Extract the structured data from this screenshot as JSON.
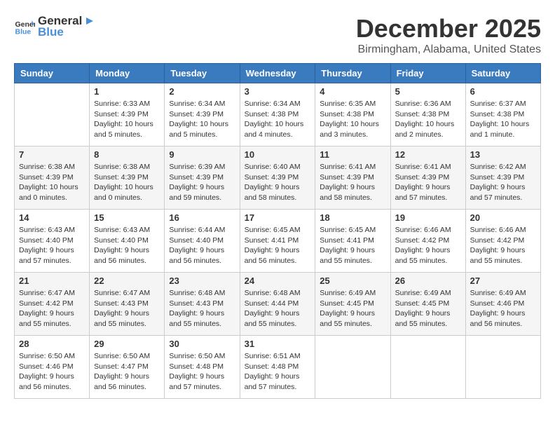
{
  "header": {
    "logo_general": "General",
    "logo_blue": "Blue",
    "month_title": "December 2025",
    "location": "Birmingham, Alabama, United States"
  },
  "days_of_week": [
    "Sunday",
    "Monday",
    "Tuesday",
    "Wednesday",
    "Thursday",
    "Friday",
    "Saturday"
  ],
  "weeks": [
    [
      {
        "day": "",
        "info": ""
      },
      {
        "day": "1",
        "info": "Sunrise: 6:33 AM\nSunset: 4:39 PM\nDaylight: 10 hours\nand 5 minutes."
      },
      {
        "day": "2",
        "info": "Sunrise: 6:34 AM\nSunset: 4:39 PM\nDaylight: 10 hours\nand 5 minutes."
      },
      {
        "day": "3",
        "info": "Sunrise: 6:34 AM\nSunset: 4:38 PM\nDaylight: 10 hours\nand 4 minutes."
      },
      {
        "day": "4",
        "info": "Sunrise: 6:35 AM\nSunset: 4:38 PM\nDaylight: 10 hours\nand 3 minutes."
      },
      {
        "day": "5",
        "info": "Sunrise: 6:36 AM\nSunset: 4:38 PM\nDaylight: 10 hours\nand 2 minutes."
      },
      {
        "day": "6",
        "info": "Sunrise: 6:37 AM\nSunset: 4:38 PM\nDaylight: 10 hours\nand 1 minute."
      }
    ],
    [
      {
        "day": "7",
        "info": "Sunrise: 6:38 AM\nSunset: 4:39 PM\nDaylight: 10 hours\nand 0 minutes."
      },
      {
        "day": "8",
        "info": "Sunrise: 6:38 AM\nSunset: 4:39 PM\nDaylight: 10 hours\nand 0 minutes."
      },
      {
        "day": "9",
        "info": "Sunrise: 6:39 AM\nSunset: 4:39 PM\nDaylight: 9 hours\nand 59 minutes."
      },
      {
        "day": "10",
        "info": "Sunrise: 6:40 AM\nSunset: 4:39 PM\nDaylight: 9 hours\nand 58 minutes."
      },
      {
        "day": "11",
        "info": "Sunrise: 6:41 AM\nSunset: 4:39 PM\nDaylight: 9 hours\nand 58 minutes."
      },
      {
        "day": "12",
        "info": "Sunrise: 6:41 AM\nSunset: 4:39 PM\nDaylight: 9 hours\nand 57 minutes."
      },
      {
        "day": "13",
        "info": "Sunrise: 6:42 AM\nSunset: 4:39 PM\nDaylight: 9 hours\nand 57 minutes."
      }
    ],
    [
      {
        "day": "14",
        "info": "Sunrise: 6:43 AM\nSunset: 4:40 PM\nDaylight: 9 hours\nand 57 minutes."
      },
      {
        "day": "15",
        "info": "Sunrise: 6:43 AM\nSunset: 4:40 PM\nDaylight: 9 hours\nand 56 minutes."
      },
      {
        "day": "16",
        "info": "Sunrise: 6:44 AM\nSunset: 4:40 PM\nDaylight: 9 hours\nand 56 minutes."
      },
      {
        "day": "17",
        "info": "Sunrise: 6:45 AM\nSunset: 4:41 PM\nDaylight: 9 hours\nand 56 minutes."
      },
      {
        "day": "18",
        "info": "Sunrise: 6:45 AM\nSunset: 4:41 PM\nDaylight: 9 hours\nand 55 minutes."
      },
      {
        "day": "19",
        "info": "Sunrise: 6:46 AM\nSunset: 4:42 PM\nDaylight: 9 hours\nand 55 minutes."
      },
      {
        "day": "20",
        "info": "Sunrise: 6:46 AM\nSunset: 4:42 PM\nDaylight: 9 hours\nand 55 minutes."
      }
    ],
    [
      {
        "day": "21",
        "info": "Sunrise: 6:47 AM\nSunset: 4:42 PM\nDaylight: 9 hours\nand 55 minutes."
      },
      {
        "day": "22",
        "info": "Sunrise: 6:47 AM\nSunset: 4:43 PM\nDaylight: 9 hours\nand 55 minutes."
      },
      {
        "day": "23",
        "info": "Sunrise: 6:48 AM\nSunset: 4:43 PM\nDaylight: 9 hours\nand 55 minutes."
      },
      {
        "day": "24",
        "info": "Sunrise: 6:48 AM\nSunset: 4:44 PM\nDaylight: 9 hours\nand 55 minutes."
      },
      {
        "day": "25",
        "info": "Sunrise: 6:49 AM\nSunset: 4:45 PM\nDaylight: 9 hours\nand 55 minutes."
      },
      {
        "day": "26",
        "info": "Sunrise: 6:49 AM\nSunset: 4:45 PM\nDaylight: 9 hours\nand 55 minutes."
      },
      {
        "day": "27",
        "info": "Sunrise: 6:49 AM\nSunset: 4:46 PM\nDaylight: 9 hours\nand 56 minutes."
      }
    ],
    [
      {
        "day": "28",
        "info": "Sunrise: 6:50 AM\nSunset: 4:46 PM\nDaylight: 9 hours\nand 56 minutes."
      },
      {
        "day": "29",
        "info": "Sunrise: 6:50 AM\nSunset: 4:47 PM\nDaylight: 9 hours\nand 56 minutes."
      },
      {
        "day": "30",
        "info": "Sunrise: 6:50 AM\nSunset: 4:48 PM\nDaylight: 9 hours\nand 57 minutes."
      },
      {
        "day": "31",
        "info": "Sunrise: 6:51 AM\nSunset: 4:48 PM\nDaylight: 9 hours\nand 57 minutes."
      },
      {
        "day": "",
        "info": ""
      },
      {
        "day": "",
        "info": ""
      },
      {
        "day": "",
        "info": ""
      }
    ]
  ]
}
